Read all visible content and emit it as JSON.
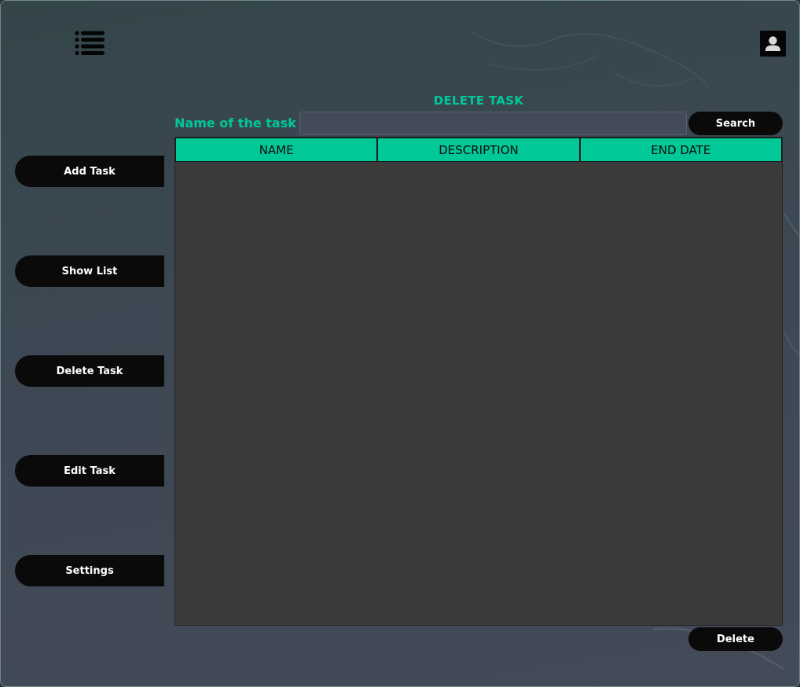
{
  "header": {
    "menu_icon": "list-menu-icon",
    "user_icon": "user-account-icon"
  },
  "sidebar": {
    "items": [
      {
        "label": "Add Task"
      },
      {
        "label": "Show List"
      },
      {
        "label": "Delete Task"
      },
      {
        "label": "Edit Task"
      },
      {
        "label": "Settings"
      }
    ]
  },
  "main": {
    "title": "DELETE TASK",
    "search_label": "Name of the task",
    "search_value": "",
    "search_placeholder": "",
    "search_button": "Search",
    "table": {
      "columns": [
        "NAME",
        "DESCRIPTION",
        "END DATE"
      ],
      "rows": []
    },
    "delete_button": "Delete"
  },
  "colors": {
    "accent": "#00c896",
    "button_bg": "#0a0a0a",
    "table_bg": "#3b3b3b",
    "input_bg": "#434a5a"
  }
}
